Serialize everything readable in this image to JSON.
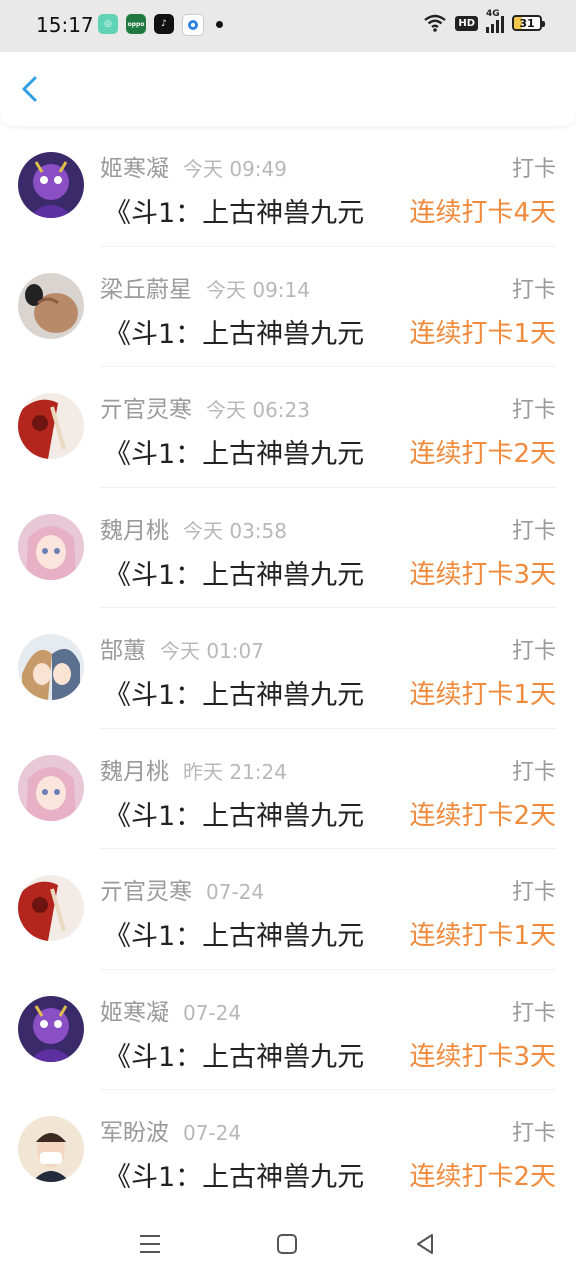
{
  "status_bar": {
    "time": "15:17",
    "network": "4G",
    "hd": "HD",
    "battery": "31"
  },
  "header": {
    "back_icon": "chevron-left-icon",
    "accent_color": "#2f9ee8"
  },
  "checkins": [
    {
      "name": "姬寒凝",
      "time": "今天 09:49",
      "type": "打卡",
      "book": "《斗1：上古神兽九元",
      "streak": "连续打卡4天",
      "avatar": "purple-warrior"
    },
    {
      "name": "梁丘蔚星",
      "time": "今天 09:14",
      "type": "打卡",
      "book": "《斗1：上古神兽九元",
      "streak": "连续打卡1天",
      "avatar": "muscle-man"
    },
    {
      "name": "亓官灵寒",
      "time": "今天 06:23",
      "type": "打卡",
      "book": "《斗1：上古神兽九元",
      "streak": "连续打卡2天",
      "avatar": "red-warrior"
    },
    {
      "name": "魏月桃",
      "time": "今天 03:58",
      "type": "打卡",
      "book": "《斗1：上古神兽九元",
      "streak": "连续打卡3天",
      "avatar": "anime-girl-pink"
    },
    {
      "name": "郜蕙",
      "time": "今天 01:07",
      "type": "打卡",
      "book": "《斗1：上古神兽九元",
      "streak": "连续打卡1天",
      "avatar": "anime-couple"
    },
    {
      "name": "魏月桃",
      "time": "昨天 21:24",
      "type": "打卡",
      "book": "《斗1：上古神兽九元",
      "streak": "连续打卡2天",
      "avatar": "anime-girl-pink"
    },
    {
      "name": "亓官灵寒",
      "time": "07-24",
      "type": "打卡",
      "book": "《斗1：上古神兽九元",
      "streak": "连续打卡1天",
      "avatar": "red-warrior"
    },
    {
      "name": "姬寒凝",
      "time": "07-24",
      "type": "打卡",
      "book": "《斗1：上古神兽九元",
      "streak": "连续打卡3天",
      "avatar": "purple-warrior"
    },
    {
      "name": "军盼波",
      "time": "07-24",
      "type": "打卡",
      "book": "《斗1：上古神兽九元",
      "streak": "连续打卡2天",
      "avatar": "masked-boy"
    }
  ],
  "colors": {
    "streak": "#f08a3c",
    "name": "#9a9a9a",
    "time": "#b8b8b8",
    "book": "#222222"
  },
  "nav": {
    "menu_icon": "menu-icon",
    "home_icon": "home-square-icon",
    "back_icon": "back-triangle-icon"
  }
}
